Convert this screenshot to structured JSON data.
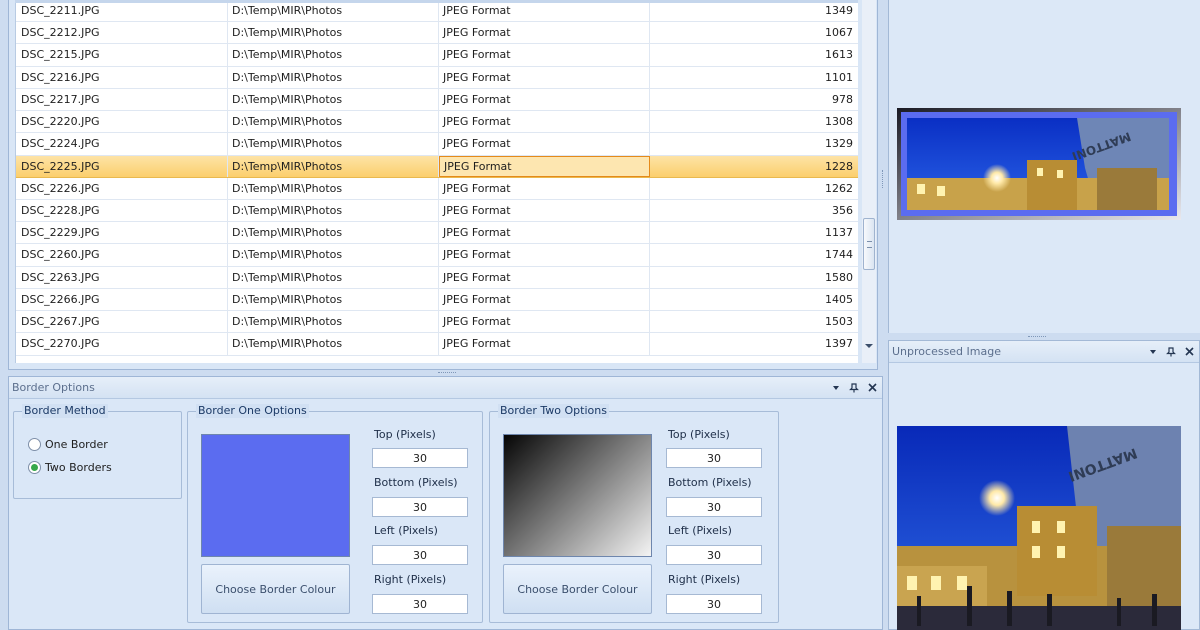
{
  "grid": {
    "rows": [
      {
        "name": "DSC_2211.JPG",
        "folder": "D:\\Temp\\MIR\\Photos",
        "type": "JPEG Format",
        "size": "1349"
      },
      {
        "name": "DSC_2212.JPG",
        "folder": "D:\\Temp\\MIR\\Photos",
        "type": "JPEG Format",
        "size": "1067"
      },
      {
        "name": "DSC_2215.JPG",
        "folder": "D:\\Temp\\MIR\\Photos",
        "type": "JPEG Format",
        "size": "1613"
      },
      {
        "name": "DSC_2216.JPG",
        "folder": "D:\\Temp\\MIR\\Photos",
        "type": "JPEG Format",
        "size": "1101"
      },
      {
        "name": "DSC_2217.JPG",
        "folder": "D:\\Temp\\MIR\\Photos",
        "type": "JPEG Format",
        "size": "978"
      },
      {
        "name": "DSC_2220.JPG",
        "folder": "D:\\Temp\\MIR\\Photos",
        "type": "JPEG Format",
        "size": "1308"
      },
      {
        "name": "DSC_2224.JPG",
        "folder": "D:\\Temp\\MIR\\Photos",
        "type": "JPEG Format",
        "size": "1329"
      },
      {
        "name": "DSC_2225.JPG",
        "folder": "D:\\Temp\\MIR\\Photos",
        "type": "JPEG Format",
        "size": "1228",
        "selected": true
      },
      {
        "name": "DSC_2226.JPG",
        "folder": "D:\\Temp\\MIR\\Photos",
        "type": "JPEG Format",
        "size": "1262"
      },
      {
        "name": "DSC_2228.JPG",
        "folder": "D:\\Temp\\MIR\\Photos",
        "type": "JPEG Format",
        "size": "356"
      },
      {
        "name": "DSC_2229.JPG",
        "folder": "D:\\Temp\\MIR\\Photos",
        "type": "JPEG Format",
        "size": "1137"
      },
      {
        "name": "DSC_2260.JPG",
        "folder": "D:\\Temp\\MIR\\Photos",
        "type": "JPEG Format",
        "size": "1744"
      },
      {
        "name": "DSC_2263.JPG",
        "folder": "D:\\Temp\\MIR\\Photos",
        "type": "JPEG Format",
        "size": "1580"
      },
      {
        "name": "DSC_2266.JPG",
        "folder": "D:\\Temp\\MIR\\Photos",
        "type": "JPEG Format",
        "size": "1405"
      },
      {
        "name": "DSC_2267.JPG",
        "folder": "D:\\Temp\\MIR\\Photos",
        "type": "JPEG Format",
        "size": "1503"
      },
      {
        "name": "DSC_2270.JPG",
        "folder": "D:\\Temp\\MIR\\Photos",
        "type": "JPEG Format",
        "size": "1397"
      }
    ]
  },
  "border_panel": {
    "title": "Border Options",
    "method": {
      "title": "Border Method",
      "options": [
        "One Border",
        "Two Borders"
      ],
      "selected": "Two Borders"
    },
    "border_one": {
      "title": "Border One Options",
      "colour": "#5b6cf0",
      "button_label": "Choose Border Colour",
      "fields": [
        {
          "label": "Top (Pixels)",
          "value": "30"
        },
        {
          "label": "Bottom (Pixels)",
          "value": "30"
        },
        {
          "label": "Left (Pixels)",
          "value": "30"
        },
        {
          "label": "Right (Pixels)",
          "value": "30"
        }
      ]
    },
    "border_two": {
      "title": "Border Two Options",
      "gradient_from": "#050505",
      "gradient_to": "#f4f4f4",
      "button_label": "Choose Border Colour",
      "fields": [
        {
          "label": "Top (Pixels)",
          "value": "30"
        },
        {
          "label": "Bottom (Pixels)",
          "value": "30"
        },
        {
          "label": "Left (Pixels)",
          "value": "30"
        },
        {
          "label": "Right (Pixels)",
          "value": "30"
        }
      ]
    }
  },
  "unprocessed_panel": {
    "title": "Unprocessed Image"
  },
  "preview_sign_text": "MATTONI",
  "icons": {
    "dropdown": "chevron-down-icon",
    "pin": "pin-icon",
    "close": "close-icon",
    "scroll_down": "scroll-down-arrow-icon"
  }
}
